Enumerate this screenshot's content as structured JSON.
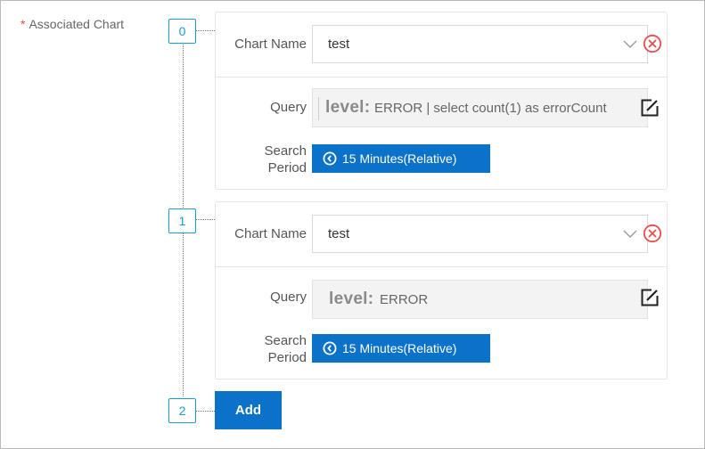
{
  "field": {
    "required_mark": "*",
    "label": "Associated Chart"
  },
  "items": [
    {
      "index": "0",
      "chart_name_label": "Chart Name",
      "chart_name_value": "test",
      "query_label": "Query",
      "query_keyword": "level:",
      "query_text": "ERROR | select count(1) as errorCount",
      "search_period_label_1": "Search",
      "search_period_label_2": "Period",
      "search_period_value": "15 Minutes(Relative)"
    },
    {
      "index": "1",
      "chart_name_label": "Chart Name",
      "chart_name_value": "test",
      "query_label": "Query",
      "query_keyword": "level:",
      "query_text": "ERROR",
      "search_period_label_1": "Search",
      "search_period_label_2": "Period",
      "search_period_value": "15 Minutes(Relative)"
    }
  ],
  "add": {
    "index": "2",
    "label": "Add"
  },
  "colors": {
    "primary": "#0a72c8",
    "index_border": "#1a9bd6",
    "remove": "#e84d4d"
  }
}
